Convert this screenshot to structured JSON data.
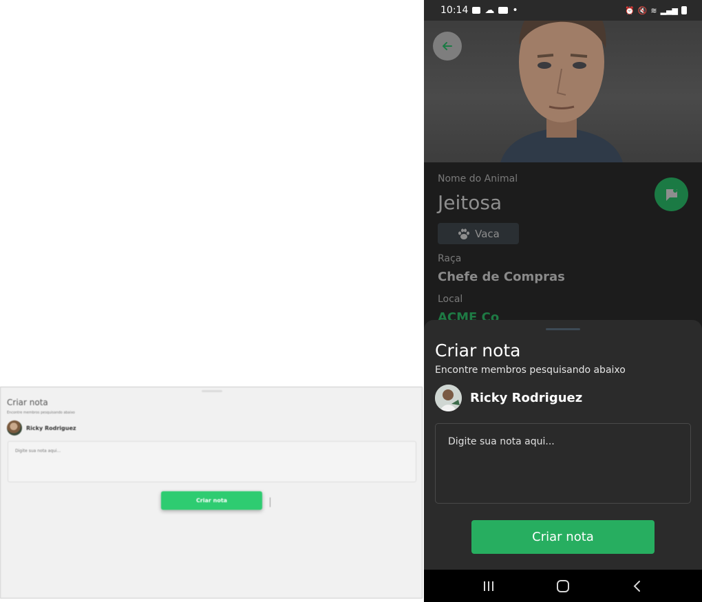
{
  "preview": {
    "title": "Criar nota",
    "subtitle": "Encontre membros pesquisando abaixo",
    "user_name": "Ricky Rodriguez",
    "placeholder": "Digite sua nota aqui...",
    "button_label": "Criar nota"
  },
  "status_bar": {
    "time": "10:14",
    "left_icons": [
      "image-icon",
      "cloud-icon",
      "youtube-icon",
      "dot-icon"
    ],
    "right_icons": [
      "alarm-icon",
      "mute-icon",
      "wifi-icon",
      "signal-icon",
      "battery-icon"
    ]
  },
  "header": {
    "back_icon": "arrow-left-icon"
  },
  "animal": {
    "name_label": "Nome do Animal",
    "name": "Jeitosa",
    "species_icon": "paw-icon",
    "species": "Vaca",
    "breed_label": "Raça",
    "breed": "Chefe de Compras",
    "location_label": "Local",
    "location": "ACME Co"
  },
  "note_fab": {
    "icon": "note-flag-icon"
  },
  "sheet": {
    "title": "Criar nota",
    "subtitle": "Encontre membros pesquisando abaixo",
    "user_name": "Ricky Rodriguez",
    "note_placeholder": "Digite sua nota aqui...",
    "create_label": "Criar nota"
  },
  "nav": {
    "icons": [
      "recent-apps-icon",
      "home-icon",
      "back-icon"
    ]
  },
  "colors": {
    "accent": "#27ae60",
    "sheet_bg": "#2b2b2b",
    "screen_bg": "#1c1c1c"
  }
}
